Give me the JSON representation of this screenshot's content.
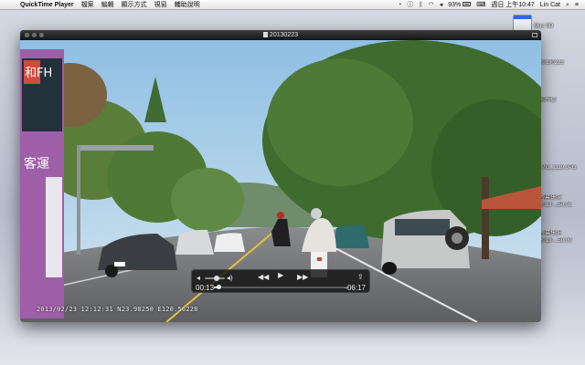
{
  "menubar": {
    "apple_glyph": "",
    "app_name": "QuickTime Player",
    "items": [
      {
        "label": "檔案"
      },
      {
        "label": "編輯"
      },
      {
        "label": "顯示方式"
      },
      {
        "label": "視窗"
      },
      {
        "label": "輔助說明"
      }
    ],
    "battery_percent": "93%",
    "datetime": "週日 上午10:47",
    "user": "Lin Cat",
    "spotlight_glyph": "⌕",
    "list_glyph": "≡"
  },
  "desktop": {
    "drive_label": "Mac SD",
    "items": [
      {
        "label": "20130223"
      },
      {
        "label": "影片檔"
      },
      {
        "label": "IMG_1119.JPG"
      },
      {
        "label": "螢幕快照"
      },
      {
        "label": "2013-...50.01"
      },
      {
        "label": "螢幕快照"
      },
      {
        "label": "2013-...50.09"
      }
    ]
  },
  "player": {
    "title": "20130223",
    "video_overlay_timestamp": "2013/02/23 12:12:31 N23.98250 E120.56228",
    "bus_sign_text": "和FH",
    "bus_body_text": "客運",
    "controls": {
      "time_elapsed": "00:13",
      "time_remaining": "-06:17",
      "progress_fraction": 0.033,
      "volume_fraction": 0.6,
      "rewind_glyph": "◀◀",
      "play_glyph": "▶",
      "ffwd_glyph": "▶▶",
      "vol_low_glyph": "◂",
      "vol_high_glyph": "◂)",
      "share_glyph": "⇪"
    }
  },
  "colors": {
    "accent": "#2e6ce0",
    "sky": "#a9cde6",
    "road": "#6f7073",
    "foliage": "#3e6b2e"
  }
}
